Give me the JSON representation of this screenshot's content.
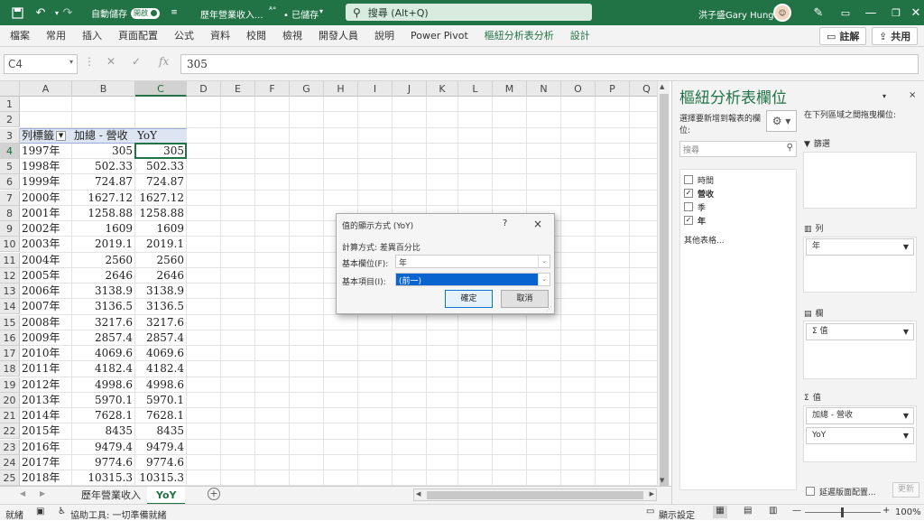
{
  "titlebar": {
    "autosave_label": "自動儲存",
    "autosave_state": "開啟",
    "doc_title": "歷年營業收入...",
    "save_status": "• 已儲存",
    "search_placeholder": "搜尋 (Alt+Q)",
    "user_name": "洪子盛Gary Hung",
    "accent_color": "#217346"
  },
  "ribbon": {
    "tabs": [
      "檔案",
      "常用",
      "插入",
      "頁面配置",
      "公式",
      "資料",
      "校閱",
      "檢視",
      "開發人員",
      "說明",
      "Power Pivot",
      "樞紐分析表分析",
      "設計"
    ],
    "comment_btn": "註解",
    "share_btn": "共用"
  },
  "formula_bar": {
    "name_box": "C4",
    "fx": "fx",
    "value": "305"
  },
  "grid": {
    "columns": [
      "A",
      "B",
      "C",
      "D",
      "E",
      "F",
      "G",
      "H",
      "I",
      "J",
      "K",
      "L",
      "M",
      "N",
      "O",
      "P",
      "Q"
    ],
    "selected_column": "C",
    "selected_row": "4",
    "rows": [
      "1",
      "2",
      "3",
      "4",
      "5",
      "6",
      "7",
      "8",
      "9",
      "10",
      "11",
      "12",
      "13",
      "14",
      "15",
      "16",
      "17",
      "18",
      "19",
      "20",
      "21",
      "22",
      "23",
      "24",
      "25"
    ],
    "pivot_header": {
      "a": "列標籤",
      "b": "加總 - 營收",
      "c": "YoY"
    },
    "pivot_rows": [
      {
        "year": "1997年",
        "revenue": "305",
        "yoy": "305"
      },
      {
        "year": "1998年",
        "revenue": "502.33",
        "yoy": "502.33"
      },
      {
        "year": "1999年",
        "revenue": "724.87",
        "yoy": "724.87"
      },
      {
        "year": "2000年",
        "revenue": "1627.12",
        "yoy": "1627.12"
      },
      {
        "year": "2001年",
        "revenue": "1258.88",
        "yoy": "1258.88"
      },
      {
        "year": "2002年",
        "revenue": "1609",
        "yoy": "1609"
      },
      {
        "year": "2003年",
        "revenue": "2019.1",
        "yoy": "2019.1"
      },
      {
        "year": "2004年",
        "revenue": "2560",
        "yoy": "2560"
      },
      {
        "year": "2005年",
        "revenue": "2646",
        "yoy": "2646"
      },
      {
        "year": "2006年",
        "revenue": "3138.9",
        "yoy": "3138.9"
      },
      {
        "year": "2007年",
        "revenue": "3136.5",
        "yoy": "3136.5"
      },
      {
        "year": "2008年",
        "revenue": "3217.6",
        "yoy": "3217.6"
      },
      {
        "year": "2009年",
        "revenue": "2857.4",
        "yoy": "2857.4"
      },
      {
        "year": "2010年",
        "revenue": "4069.6",
        "yoy": "4069.6"
      },
      {
        "year": "2011年",
        "revenue": "4182.4",
        "yoy": "4182.4"
      },
      {
        "year": "2012年",
        "revenue": "4998.6",
        "yoy": "4998.6"
      },
      {
        "year": "2013年",
        "revenue": "5970.1",
        "yoy": "5970.1"
      },
      {
        "year": "2014年",
        "revenue": "7628.1",
        "yoy": "7628.1"
      },
      {
        "year": "2015年",
        "revenue": "8435",
        "yoy": "8435"
      },
      {
        "year": "2016年",
        "revenue": "9479.4",
        "yoy": "9479.4"
      },
      {
        "year": "2017年",
        "revenue": "9774.6",
        "yoy": "9774.6"
      },
      {
        "year": "2018年",
        "revenue": "10315.3",
        "yoy": "10315.3"
      }
    ]
  },
  "dialog": {
    "title": "值的顯示方式 (YoY)",
    "help": "?",
    "close": "×",
    "calc_label": "計算方式: 差異百分比",
    "base_field_label": "基本欄位(F):",
    "base_field_value": "年",
    "base_item_label": "基本項目(I):",
    "base_item_value": "(前一)",
    "ok": "確定",
    "cancel": "取消"
  },
  "sheets": {
    "tabs": [
      "歷年營業收入",
      "YoY"
    ],
    "active": "YoY",
    "add": "+"
  },
  "pane": {
    "title": "樞紐分析表欄位",
    "choose_label": "選擇要新增到報表的欄位:",
    "drag_label": "在下列區域之間拖曳欄位:",
    "search_placeholder": "搜尋",
    "fields": [
      {
        "name": "時間",
        "checked": false
      },
      {
        "name": "營收",
        "checked": true
      },
      {
        "name": "季",
        "checked": false
      },
      {
        "name": "年",
        "checked": true
      }
    ],
    "more_tables": "其他表格...",
    "filters_label": "篩選",
    "columns_label": "列",
    "columns_item": "年",
    "rows_label": "欄",
    "rows_item": "Σ 值",
    "values_label": "值",
    "values_items": [
      "加總 - 營收",
      "YoY"
    ],
    "defer_label": "延遲版面配置...",
    "update_btn": "更新"
  },
  "statusbar": {
    "ready": "就緒",
    "accessibility": "協助工具: 一切準備就緒",
    "display_settings": "顯示設定",
    "zoom": "100%"
  }
}
